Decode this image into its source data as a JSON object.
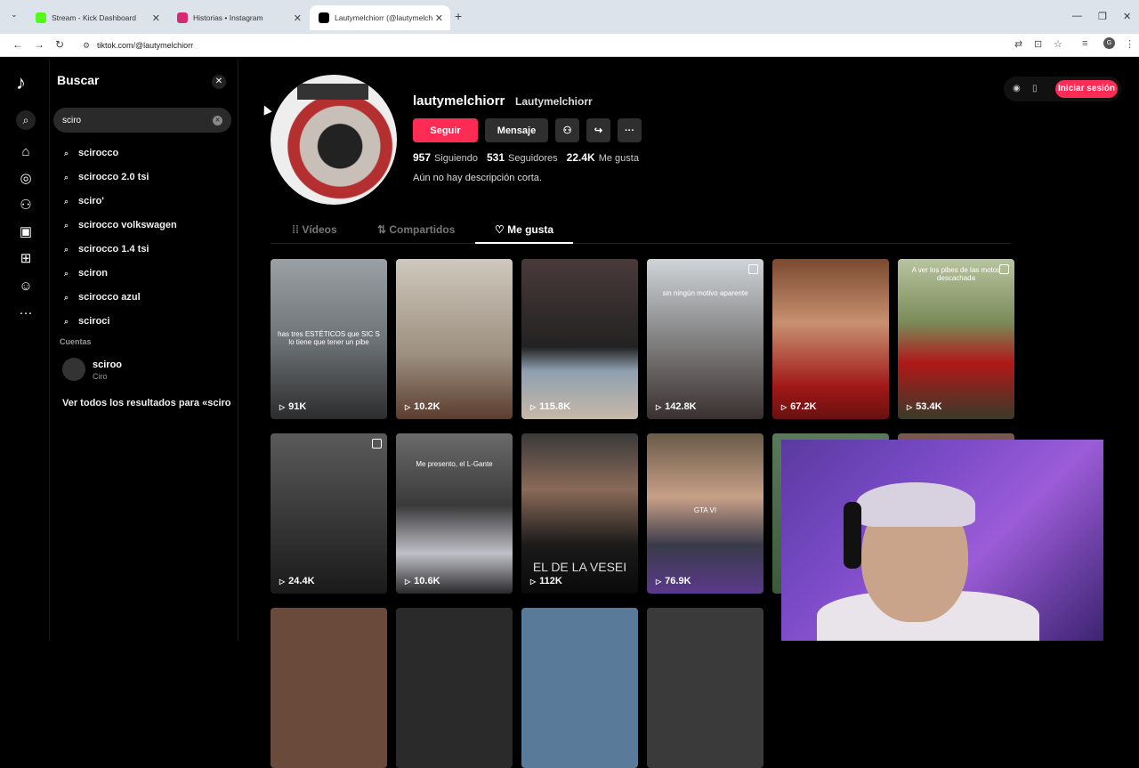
{
  "browser": {
    "tabs": [
      {
        "title": "Stream - Kick Dashboard",
        "favicon": "kick-icon",
        "color": "#53fc18"
      },
      {
        "title": "Historias • Instagram",
        "favicon": "instagram-icon",
        "color": "#d62976"
      },
      {
        "title": "Lautymelchiorr (@lautymelchio",
        "favicon": "tiktok-icon",
        "color": "#000000"
      }
    ],
    "url": "tiktok.com/@lautymelchiorr"
  },
  "search": {
    "title": "Buscar",
    "query": "sciro",
    "suggestions": [
      "scirocco",
      "scirocco 2.0 tsi",
      "sciro'",
      "scirocco volkswagen",
      "scirocco 1.4 tsi",
      "sciron",
      "scirocco azul",
      "sciroci"
    ],
    "accounts_label": "Cuentas",
    "account": {
      "name": "sciroo",
      "sub": "Ciro"
    },
    "see_all": "Ver todos los resultados para «sciro»"
  },
  "profile": {
    "username": "lautymelchiorr",
    "nickname": "Lautymelchiorr",
    "follow": "Seguir",
    "message": "Mensaje",
    "following_count": "957",
    "following_label": "Siguiendo",
    "followers_count": "531",
    "followers_label": "Seguidores",
    "likes_count": "22.4K",
    "likes_label": "Me gusta",
    "bio": "Aún no hay descripción corta.",
    "login": "Iniciar sesión",
    "tabs": [
      "Vídeos",
      "Compartidos",
      "Me gusta"
    ]
  },
  "videos": [
    {
      "views": "91K",
      "caption": "has tres ESTÉTICOS que SIC S lo tiene que tener un pibe"
    },
    {
      "views": "10.2K"
    },
    {
      "views": "115.8K"
    },
    {
      "views": "142.8K",
      "caption": "sin ningún motivo aparente"
    },
    {
      "views": "67.2K"
    },
    {
      "views": "53.4K",
      "caption": "A ver los pibes de las motos descachada"
    },
    {
      "views": "24.4K"
    },
    {
      "views": "10.6K",
      "caption": "Me presento, el L-Gante"
    },
    {
      "views": "112K",
      "caption": "EL DE LA VESEI"
    },
    {
      "views": "76.9K",
      "caption": "GTA VI"
    }
  ]
}
